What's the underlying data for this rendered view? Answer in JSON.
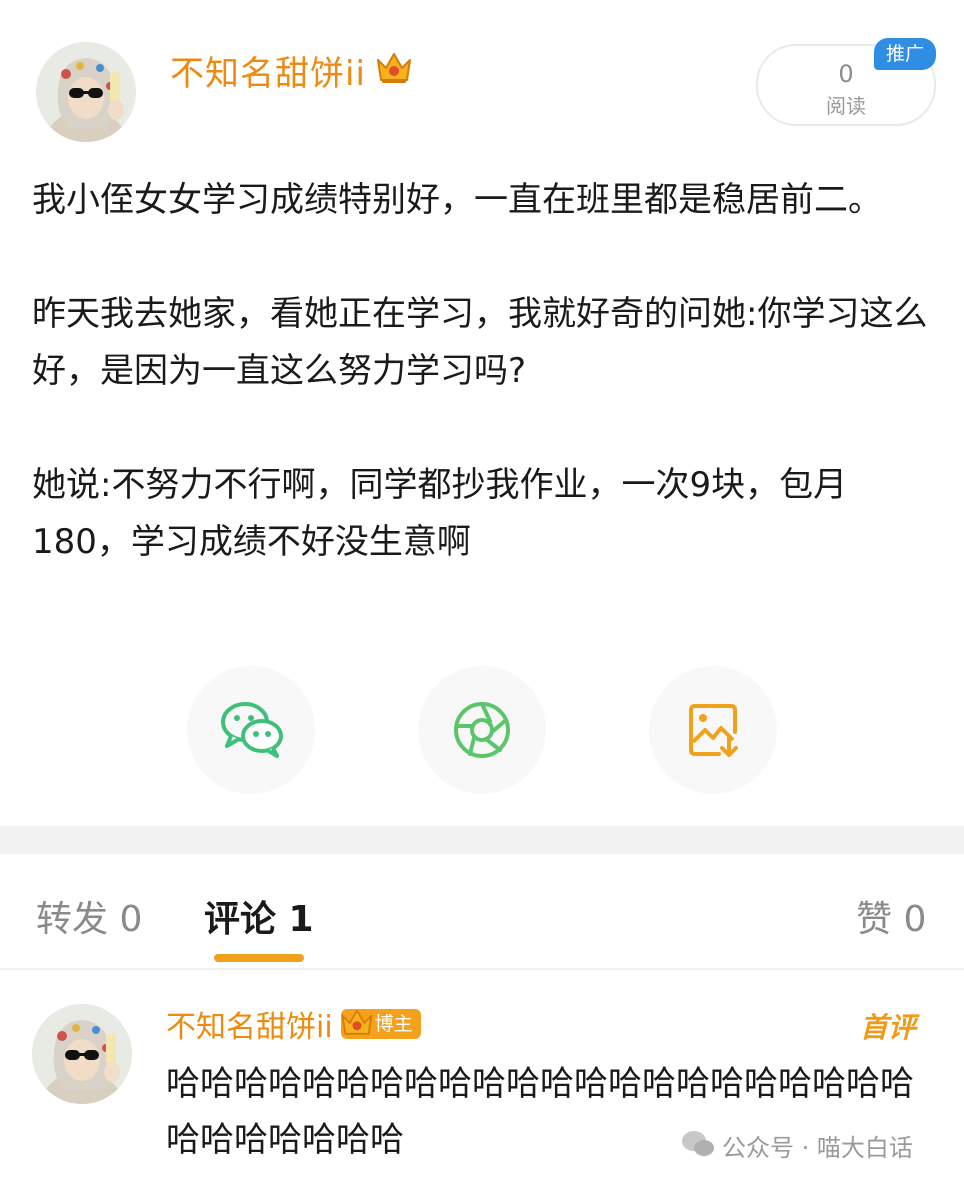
{
  "post": {
    "author": "不知名甜饼ii",
    "read_count": "0",
    "read_label": "阅读",
    "promo_badge": "推广",
    "paragraphs": [
      "我小侄女女学习成绩特别好，一直在班里都是稳居前二。",
      "昨天我去她家，看她正在学习，我就好奇的问她:你学习这么好，是因为一直这么努力学习吗?",
      "她说:不努力不行啊，同学都抄我作业，一次9块，包月180，学习成绩不好没生意啊"
    ]
  },
  "share_buttons": [
    {
      "icon": "wechat-icon",
      "color": "#3fc07a"
    },
    {
      "icon": "moments-icon",
      "color": "#5cc46a"
    },
    {
      "icon": "save-image-icon",
      "color": "#f0a21c"
    }
  ],
  "tabs": {
    "repost": "转发 0",
    "comments": "评论 1",
    "likes": "赞 0"
  },
  "comment": {
    "author": "不知名甜饼ii",
    "badge": "博主",
    "first_label": "首评",
    "text": "哈哈哈哈哈哈哈哈哈哈哈哈哈哈哈哈哈哈哈哈哈哈哈哈哈哈哈哈哈"
  },
  "watermark": "公众号 · 喵大白话",
  "colors": {
    "accent": "#ee8a10",
    "tab_underline": "#f0a21c",
    "promo": "#2f8de4"
  }
}
